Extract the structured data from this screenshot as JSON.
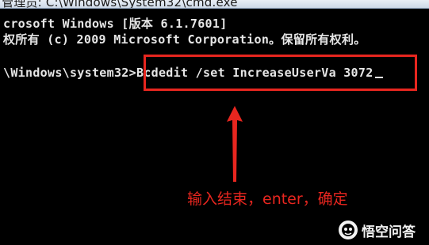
{
  "window": {
    "title": "管理员: C:\\Windows\\System32\\cmd.exe"
  },
  "console": {
    "line1": "crosoft Windows [版本 6.1.7601]",
    "line2": "权所有 (c) 2009 Microsoft Corporation。保留所有权利。",
    "prompt": "\\Windows\\system32>",
    "command": "Bcdedit /set IncreaseUserVa 3072"
  },
  "annotation": {
    "text": "输入结束，enter，确定",
    "color": "#e8261f"
  },
  "watermark": {
    "text": "悟空问答",
    "logo_icon": "wukong-logo-icon"
  }
}
